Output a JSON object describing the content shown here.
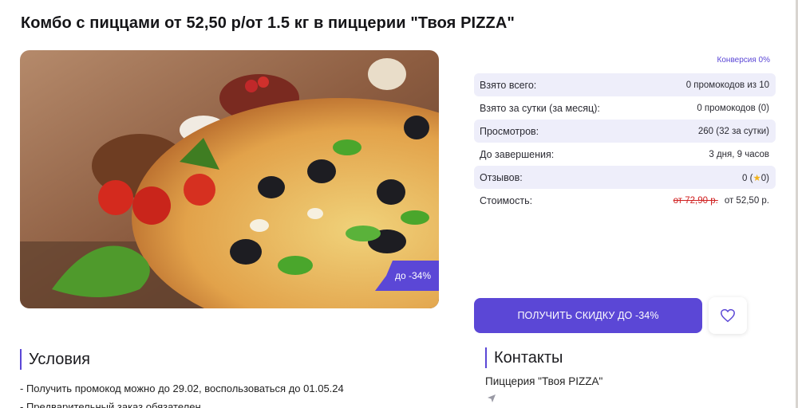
{
  "page": {
    "title": "Комбо с пиццами от 52,50 р/от 1.5 кг в пиццерии \"Твоя PIZZA\""
  },
  "hero": {
    "badge": "до -34%"
  },
  "stats": {
    "conversion": "Конверсия 0%",
    "rows": [
      {
        "label": "Взято всего:",
        "value": "0 промокодов из 10"
      },
      {
        "label": "Взято за сутки (за месяц):",
        "value": "0 промокодов (0)"
      },
      {
        "label": "Просмотров:",
        "value": "260 (32 за сутки)"
      },
      {
        "label": "До завершения:",
        "value": "3 дня, 9 часов"
      },
      {
        "label": "Отзывов:",
        "value_prefix": "0 (",
        "value_star": "★",
        "value_suffix": "0)"
      },
      {
        "label": "Стоимость:",
        "old_price": "от 72,90 р.",
        "new_price": "от 52,50 р."
      }
    ]
  },
  "actions": {
    "cta_label": "ПОЛУЧИТЬ СКИДКУ ДО -34%"
  },
  "conditions": {
    "heading": "Условия",
    "items": [
      "- Получить промокод можно до 29.02, воспользоваться до 01.05.24",
      "- Предварительный заказ обязателен"
    ]
  },
  "contacts": {
    "heading": "Контакты",
    "name": "Пиццерия \"Твоя PIZZA\""
  },
  "colors": {
    "accent": "#5b47d6",
    "old_price": "#d02020",
    "stat_shade": "#eeeefa"
  }
}
